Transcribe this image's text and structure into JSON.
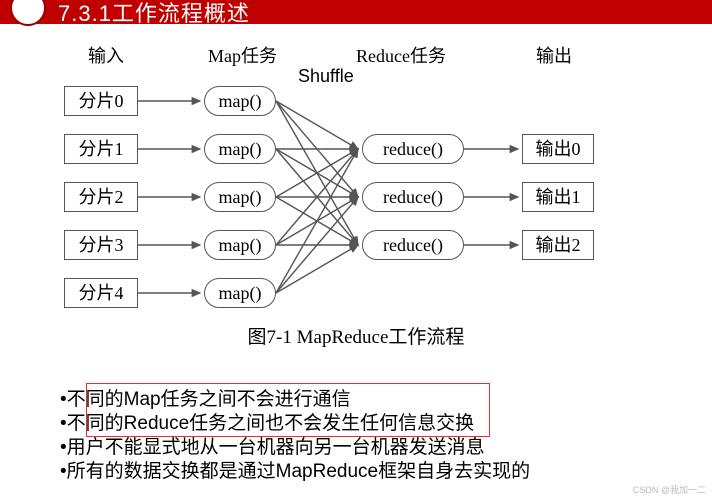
{
  "header": {
    "title": "7.3.1工作流程概述"
  },
  "columns": {
    "input": "输入",
    "map": "Map任务",
    "reduce": "Reduce任务",
    "output": "输出"
  },
  "shuffle": "Shuffle",
  "inputs": [
    "分片0",
    "分片1",
    "分片2",
    "分片3",
    "分片4"
  ],
  "maps": [
    "map()",
    "map()",
    "map()",
    "map()",
    "map()"
  ],
  "reduces": [
    "reduce()",
    "reduce()",
    "reduce()"
  ],
  "outputs": [
    "输出0",
    "输出1",
    "输出2"
  ],
  "caption": "图7-1 MapReduce工作流程",
  "bullets": [
    "不同的Map任务之间不会进行通信",
    "不同的Reduce任务之间也不会发生任何信息交换",
    "用户不能显式地从一台机器向另一台机器发送消息",
    "所有的数据交换都是通过MapReduce框架自身去实现的"
  ],
  "watermark": "CSDN @我加一二"
}
